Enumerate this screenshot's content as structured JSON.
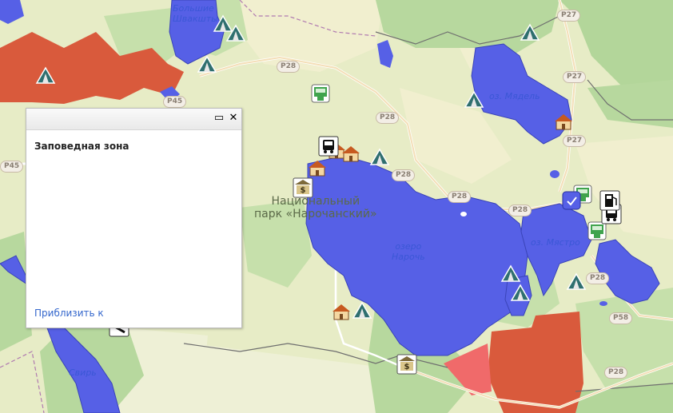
{
  "map": {
    "labels": {
      "lake_naroch": [
        "озеро",
        "Нарочь"
      ],
      "lake_myadel": "оз. Мядель",
      "lake_mastro": "оз. Мястро",
      "lake_bolshie_shvakshty": [
        "Большие",
        "Швакшты"
      ],
      "river_svir": "Свирь",
      "park": [
        "Национальный",
        "парк «Нарочанский»"
      ]
    },
    "road_shields": [
      "P28",
      "P28",
      "P28",
      "P28",
      "P28",
      "P27",
      "P27",
      "P27",
      "P45",
      "P45",
      "P28",
      "P58",
      "P28"
    ],
    "colors": {
      "water": "#5660e6",
      "forest": "#b2d69a",
      "meadow": "#dde9b8",
      "farmland": "#f1eecf",
      "reserve": "#d95a3c",
      "reserve_light": "#f06a6a"
    }
  },
  "popup": {
    "title": "Заповедная зона",
    "zoom_link": "Приблизить к",
    "maximize_icon": "▭",
    "close_icon": "✕"
  }
}
